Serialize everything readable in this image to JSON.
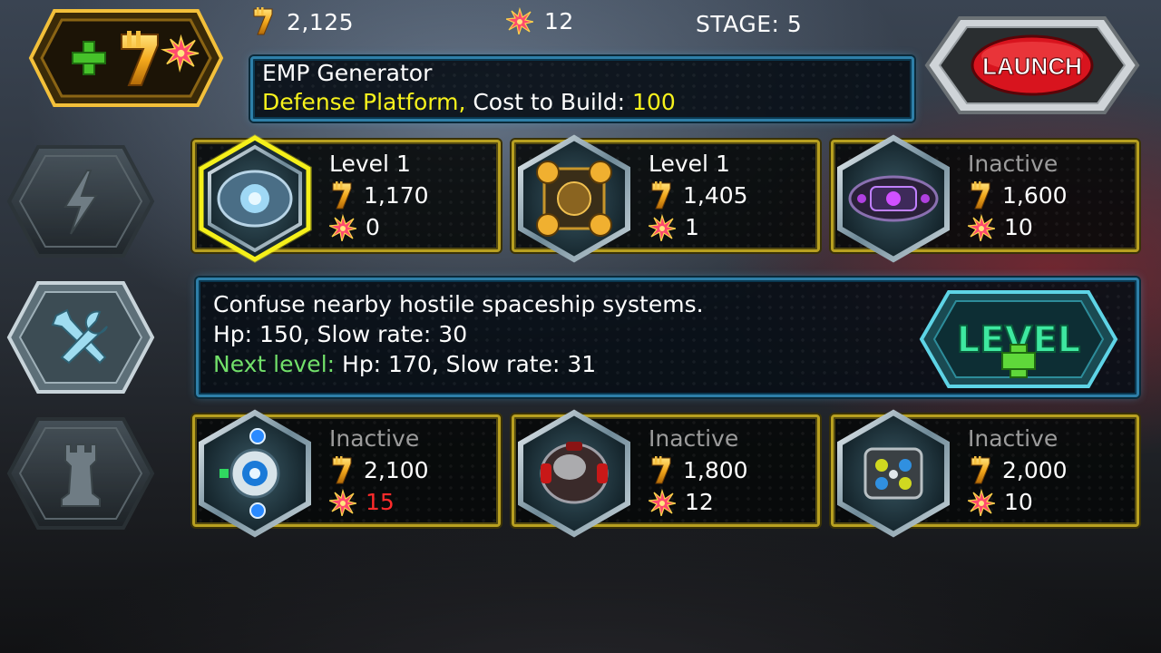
{
  "top": {
    "credits": "2,125",
    "crystals": "12",
    "stage": "STAGE: 5"
  },
  "launch": {
    "label": "LAUNCH"
  },
  "info": {
    "name": "EMP Generator",
    "type": "Defense Platform,",
    "cost_label": "Cost to Build:",
    "cost_value": "100"
  },
  "description": {
    "line1": "Confuse nearby hostile spaceship systems.",
    "line2": "Hp: 150, Slow rate: 30",
    "next_label": "Next level:",
    "next_value": "Hp: 170, Slow rate: 31"
  },
  "level_button": {
    "label": "LEVEL"
  },
  "towers": [
    {
      "status": "Level 1",
      "credits": "1,170",
      "crystals": "0"
    },
    {
      "status": "Level 1",
      "credits": "1,405",
      "crystals": "1"
    },
    {
      "status": "Inactive",
      "credits": "1,600",
      "crystals": "10"
    },
    {
      "status": "Inactive",
      "credits": "2,100",
      "crystals": "15"
    },
    {
      "status": "Inactive",
      "credits": "1,800",
      "crystals": "12"
    },
    {
      "status": "Inactive",
      "credits": "2,000",
      "crystals": "10"
    }
  ],
  "colors": {
    "accent_yellow": "#f7f21c",
    "next_green": "#72e06a",
    "insufficient_red": "#ff2b2b",
    "inactive_gray": "#9c9c9c",
    "panel_border": "#2e7fa8",
    "card_border": "#b8a020",
    "launch_red": "#d8141e"
  },
  "icons": {
    "currency": "credit-icon",
    "crystal": "crystal-icon",
    "side_tab_1": "lightning-icon",
    "side_tab_2": "tools-icon",
    "side_tab_3": "rook-icon",
    "badge": "plus-credits-icon"
  }
}
